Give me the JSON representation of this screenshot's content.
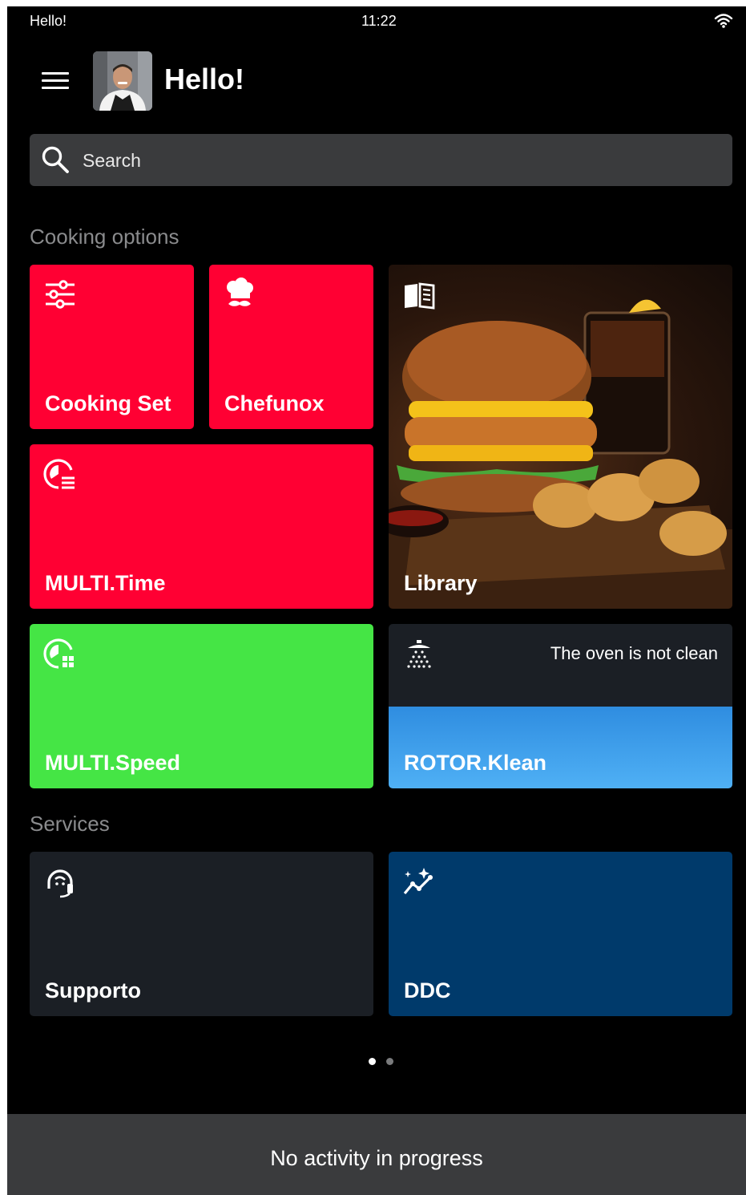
{
  "status_bar": {
    "left_text": "Hello!",
    "time": "11:22"
  },
  "header": {
    "title": "Hello!"
  },
  "search": {
    "placeholder": "Search"
  },
  "sections": {
    "cooking_options": "Cooking options",
    "services": "Services"
  },
  "tiles": {
    "cooking_set": "Cooking Set",
    "chefunox": "Chefunox",
    "multi_time": "MULTI.Time",
    "library": "Library",
    "multi_speed": "MULTI.Speed",
    "rotor_klean": "ROTOR.Klean",
    "rotor_klean_status": "The oven is not clean",
    "supporto": "Supporto",
    "ddc": "DDC"
  },
  "icons": {
    "menu": "menu-icon",
    "wifi": "wifi-icon",
    "search": "search-icon",
    "cooking_set": "sliders-icon",
    "chefunox": "chef-hat-icon",
    "multi_time": "timer-list-icon",
    "library": "book-icon",
    "multi_speed": "speed-grid-icon",
    "rotor_klean": "shower-icon",
    "supporto": "headset-icon",
    "ddc": "sparkle-chart-icon"
  },
  "pager": {
    "page_count": 2,
    "active_page": 1
  },
  "footer": {
    "activity_text": "No activity in progress"
  },
  "colors": {
    "background": "#000000",
    "tile_red": "#ff0033",
    "tile_green": "#45e545",
    "tile_dark": "#1b1f25",
    "tile_navy": "#003a6b",
    "tile_blue": "#4fb0f5",
    "search_bg": "#3a3b3d",
    "section_text": "#8a8b8d"
  }
}
